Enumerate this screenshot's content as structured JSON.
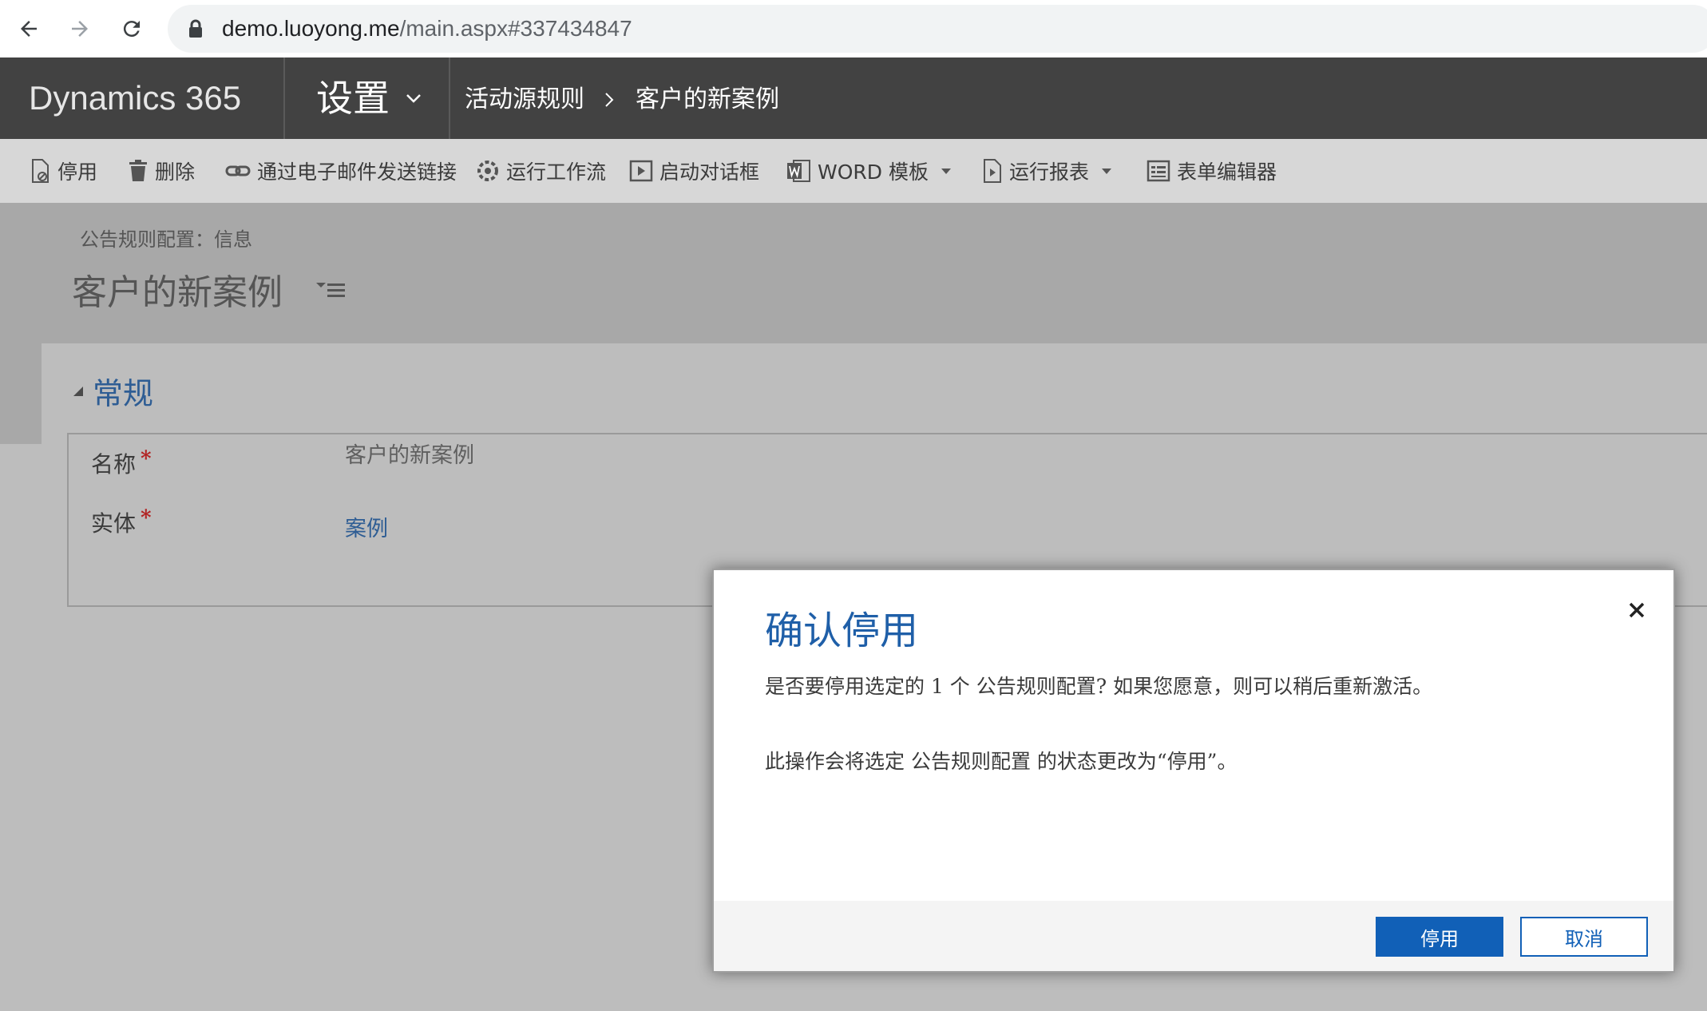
{
  "browser": {
    "url_host": "demo.luoyong.me",
    "url_path": "/main.aspx#337434847",
    "icons": [
      "back-arrow-icon",
      "forward-arrow-icon",
      "reload-icon",
      "lock-icon"
    ]
  },
  "topnav": {
    "brand": "Dynamics 365",
    "area": "设置",
    "breadcrumb": [
      "活动源规则",
      "客户的新案例"
    ]
  },
  "commands": [
    {
      "label": "停用",
      "icon": "deactivate-icon"
    },
    {
      "label": "删除",
      "icon": "trash-icon"
    },
    {
      "label": "通过电子邮件发送链接",
      "icon": "link-icon"
    },
    {
      "label": "运行工作流",
      "icon": "workflow-icon"
    },
    {
      "label": "启动对话框",
      "icon": "dialog-icon"
    },
    {
      "label": "WORD 模板",
      "icon": "word-icon",
      "dropdown": true
    },
    {
      "label": "运行报表",
      "icon": "report-icon",
      "dropdown": true
    },
    {
      "label": "表单编辑器",
      "icon": "form-editor-icon"
    }
  ],
  "form": {
    "entity_label": "公告规则配置：信息",
    "title": "客户的新案例",
    "section_title": "常规",
    "fields": [
      {
        "label": "名称",
        "required_mark": "*",
        "value": "客户的新案例"
      },
      {
        "label": "实体",
        "required_mark": "*",
        "value": "案例"
      }
    ]
  },
  "dialog": {
    "title": "确认停用",
    "message1": "是否要停用选定的 1 个 公告规则配置? 如果您愿意，则可以稍后重新激活。",
    "message2": "此操作会将选定 公告规则配置 的状态更改为“停用”。",
    "confirm_label": "停用",
    "cancel_label": "取消"
  },
  "colors": {
    "nav_bg": "#424242",
    "command_bar_bg": "#d7d7d7",
    "accent_blue": "#1160b7",
    "title_blue": "#1f5fa8"
  }
}
